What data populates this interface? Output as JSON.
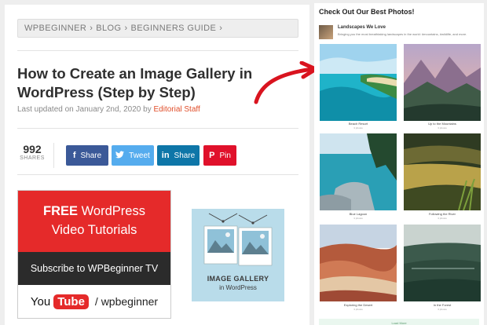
{
  "breadcrumb": {
    "items": [
      "WPBEGINNER",
      "BLOG",
      "BEGINNERS GUIDE"
    ],
    "separator": "›"
  },
  "article": {
    "title": "How to Create an Image Gallery in WordPress (Step by Step)",
    "updated_prefix": "Last updated on January 2nd, 2020 by",
    "author": "Editorial Staff"
  },
  "shares": {
    "count": "992",
    "label": "SHARES"
  },
  "social": [
    {
      "label": "Share",
      "icon": "facebook-icon",
      "glyph": "f",
      "color": "#3b5998"
    },
    {
      "label": "Tweet",
      "icon": "twitter-icon",
      "glyph": "t",
      "color": "#55acee"
    },
    {
      "label": "Share",
      "icon": "linkedin-icon",
      "glyph": "in",
      "color": "#0e76a8"
    },
    {
      "label": "Pin",
      "icon": "pinterest-icon",
      "glyph": "P",
      "color": "#e0112b"
    }
  ],
  "promo": {
    "free": "FREE",
    "line1_rest": "WordPress",
    "line2": "Video Tutorials",
    "subscribe": "Subscribe to WPBeginner TV",
    "you": "You",
    "tube": "Tube",
    "handle": "/ wpbeginner"
  },
  "gallery_thumb": {
    "line1": "IMAGE GALLERY",
    "line2": "in WordPress"
  },
  "sidebar": {
    "title": "Check Out Our Best Photos!",
    "profile_name": "Landscapes We Love",
    "profile_desc": "Bringing you the most breathtaking landscapes in the world: #mountains, #wildlife, and more.",
    "photos": [
      {
        "caption": "Beach Resort",
        "sub": "3 photos"
      },
      {
        "caption": "Up to the Mountains",
        "sub": "3 photos"
      },
      {
        "caption": "Blue Lagoon",
        "sub": "3 photos"
      },
      {
        "caption": "Following the River",
        "sub": "3 photos"
      },
      {
        "caption": "Exploring the Desert",
        "sub": "3 photos"
      },
      {
        "caption": "In the Forest",
        "sub": "3 photos"
      }
    ],
    "load_more": "Load More"
  },
  "colors": {
    "accent_red": "#e52a2a",
    "author_link": "#e04e2a",
    "arrow": "#d9141f"
  }
}
